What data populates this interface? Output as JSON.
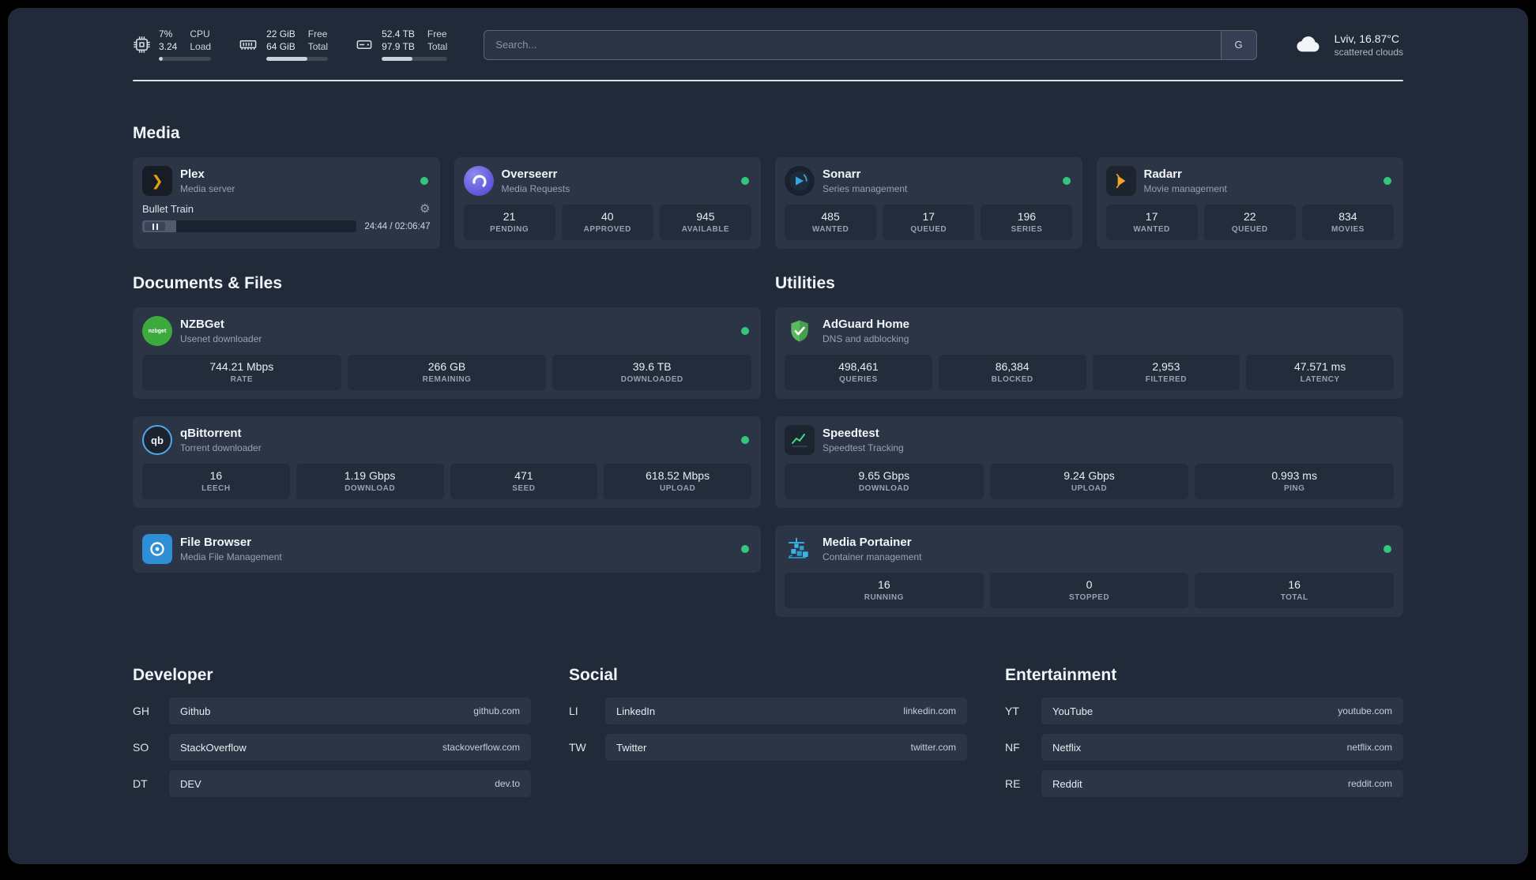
{
  "colors": {
    "background": "#212a38",
    "card": "#2c3546",
    "stat_tile": "#232c3b",
    "status_online": "#34c77b",
    "plex": "#e5a00d",
    "overseerr": "#6366f1",
    "sonarr": "#35a5e5",
    "radarr": "#f5a623",
    "nzbget": "#3daa3d",
    "qbittorrent": "#4fa8e8",
    "adguard": "#5bb85f",
    "speedtest": "#3ddc84",
    "portainer": "#38b6e8",
    "filebrowser": "#2f8fd6"
  },
  "topbar": {
    "resources": [
      {
        "icon": "cpu-icon",
        "v1": "7%",
        "l1": "CPU",
        "v2": "3.24",
        "l2": "Load",
        "progress": 7
      },
      {
        "icon": "memory-icon",
        "v1": "22 GiB",
        "l1": "Free",
        "v2": "64 GiB",
        "l2": "Total",
        "progress": 66
      },
      {
        "icon": "disk-icon",
        "v1": "52.4 TB",
        "l1": "Free",
        "v2": "97.9 TB",
        "l2": "Total",
        "progress": 47
      }
    ],
    "search": {
      "placeholder": "Search...",
      "button_label": "G"
    },
    "weather": {
      "location": "Lviv, 16.87°C",
      "condition": "scattered clouds"
    }
  },
  "sections": {
    "media": {
      "title": "Media",
      "cards": [
        {
          "name": "Plex",
          "subtitle": "Media server",
          "status": "online",
          "player": {
            "track": "Bullet Train",
            "time": "24:44 / 02:06:47",
            "progress": 16
          }
        },
        {
          "name": "Overseerr",
          "subtitle": "Media Requests",
          "status": "online",
          "stats": [
            {
              "value": "21",
              "label": "PENDING"
            },
            {
              "value": "40",
              "label": "APPROVED"
            },
            {
              "value": "945",
              "label": "AVAILABLE"
            }
          ]
        },
        {
          "name": "Sonarr",
          "subtitle": "Series management",
          "status": "online",
          "stats": [
            {
              "value": "485",
              "label": "WANTED"
            },
            {
              "value": "17",
              "label": "QUEUED"
            },
            {
              "value": "196",
              "label": "SERIES"
            }
          ]
        },
        {
          "name": "Radarr",
          "subtitle": "Movie management",
          "status": "online",
          "stats": [
            {
              "value": "17",
              "label": "WANTED"
            },
            {
              "value": "22",
              "label": "QUEUED"
            },
            {
              "value": "834",
              "label": "MOVIES"
            }
          ]
        }
      ]
    },
    "documents": {
      "title": "Documents & Files",
      "cards": [
        {
          "name": "NZBGet",
          "subtitle": "Usenet downloader",
          "status": "online",
          "stats": [
            {
              "value": "744.21 Mbps",
              "label": "RATE"
            },
            {
              "value": "266 GB",
              "label": "REMAINING"
            },
            {
              "value": "39.6 TB",
              "label": "DOWNLOADED"
            }
          ]
        },
        {
          "name": "qBittorrent",
          "subtitle": "Torrent downloader",
          "status": "online",
          "stats": [
            {
              "value": "16",
              "label": "LEECH"
            },
            {
              "value": "1.19 Gbps",
              "label": "DOWNLOAD"
            },
            {
              "value": "471",
              "label": "SEED"
            },
            {
              "value": "618.52 Mbps",
              "label": "UPLOAD"
            }
          ]
        },
        {
          "name": "File Browser",
          "subtitle": "Media File Management",
          "status": "online"
        }
      ]
    },
    "utilities": {
      "title": "Utilities",
      "cards": [
        {
          "name": "AdGuard Home",
          "subtitle": "DNS and adblocking",
          "stats": [
            {
              "value": "498,461",
              "label": "QUERIES"
            },
            {
              "value": "86,384",
              "label": "BLOCKED"
            },
            {
              "value": "2,953",
              "label": "FILTERED"
            },
            {
              "value": "47.571 ms",
              "label": "LATENCY"
            }
          ]
        },
        {
          "name": "Speedtest",
          "subtitle": "Speedtest Tracking",
          "stats": [
            {
              "value": "9.65 Gbps",
              "label": "DOWNLOAD"
            },
            {
              "value": "9.24 Gbps",
              "label": "UPLOAD"
            },
            {
              "value": "0.993 ms",
              "label": "PING"
            }
          ]
        },
        {
          "name": "Media Portainer",
          "subtitle": "Container management",
          "status": "online",
          "stats": [
            {
              "value": "16",
              "label": "RUNNING"
            },
            {
              "value": "0",
              "label": "STOPPED"
            },
            {
              "value": "16",
              "label": "TOTAL"
            }
          ]
        }
      ]
    }
  },
  "bookmarks": [
    {
      "title": "Developer",
      "items": [
        {
          "abbr": "GH",
          "name": "Github",
          "url": "github.com"
        },
        {
          "abbr": "SO",
          "name": "StackOverflow",
          "url": "stackoverflow.com"
        },
        {
          "abbr": "DT",
          "name": "DEV",
          "url": "dev.to"
        }
      ]
    },
    {
      "title": "Social",
      "items": [
        {
          "abbr": "LI",
          "name": "LinkedIn",
          "url": "linkedin.com"
        },
        {
          "abbr": "TW",
          "name": "Twitter",
          "url": "twitter.com"
        }
      ]
    },
    {
      "title": "Entertainment",
      "items": [
        {
          "abbr": "YT",
          "name": "YouTube",
          "url": "youtube.com"
        },
        {
          "abbr": "NF",
          "name": "Netflix",
          "url": "netflix.com"
        },
        {
          "abbr": "RE",
          "name": "Reddit",
          "url": "reddit.com"
        }
      ]
    }
  ]
}
